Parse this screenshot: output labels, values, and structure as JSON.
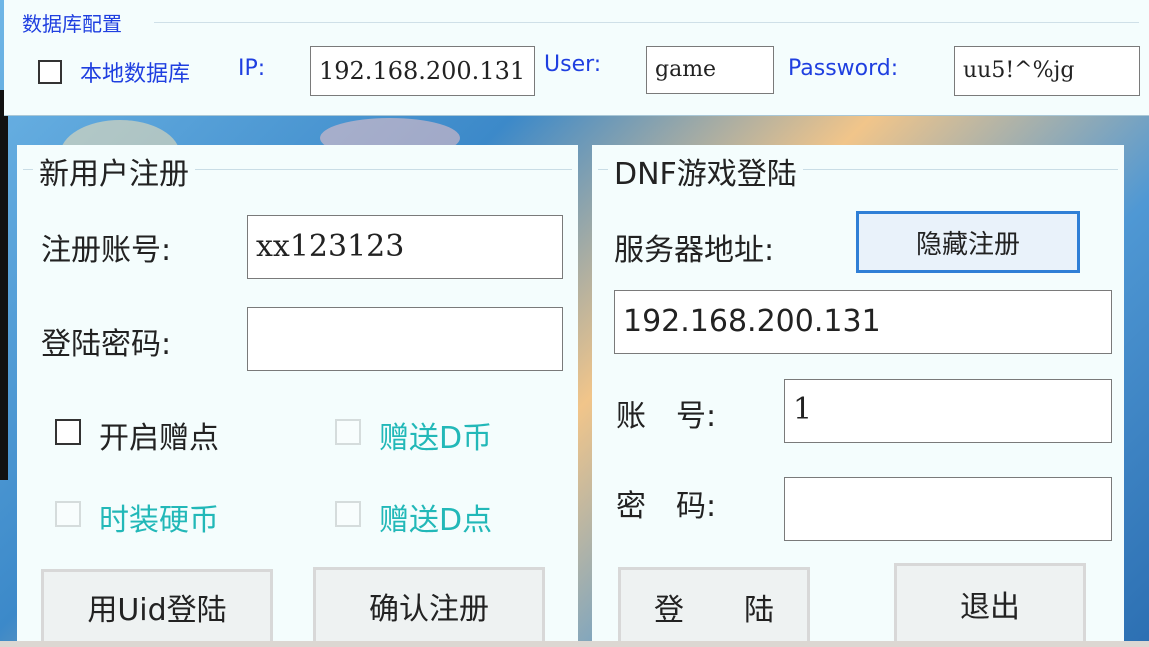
{
  "db_config": {
    "title": "数据库配置",
    "local_db_label": "本地数据库",
    "local_db_checked": false,
    "ip_label": "IP:",
    "ip_value": "192.168.200.131",
    "user_label": "User:",
    "user_value": "game",
    "password_label": "Password:",
    "password_value": "uu5!^%jg"
  },
  "register": {
    "title": "新用户注册",
    "account_label": "注册账号:",
    "account_value": "xx123123",
    "password_label": "登陆密码:",
    "password_value": "",
    "enable_points_label": "开启赠点",
    "gift_d_coin_label": "赠送D币",
    "fashion_coin_label": "时装硬币",
    "gift_d_points_label": "赠送D点",
    "uid_login_button": "用Uid登陆",
    "confirm_register_button": "确认注册"
  },
  "login": {
    "title": "DNF游戏登陆",
    "server_label": "服务器地址:",
    "hide_register_button": "隐藏注册",
    "server_value": "192.168.200.131",
    "account_label": "账　号:",
    "account_value": "1",
    "password_label": "密　码:",
    "password_value": "",
    "login_button": "登　　陆",
    "exit_button": "退出"
  },
  "colors": {
    "legend_blue": "#1f3fe0",
    "disabled_teal": "#22b8b8",
    "focus_border": "#2f7fd6"
  }
}
